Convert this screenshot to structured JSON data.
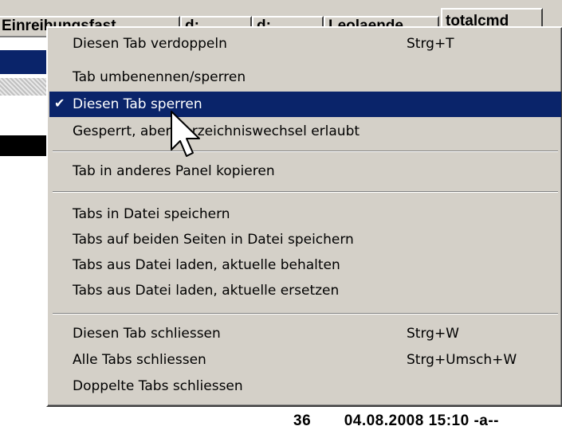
{
  "tabs": [
    {
      "label": "Einreibungsfast"
    },
    {
      "label": "d:"
    },
    {
      "label": "d:"
    },
    {
      "label": "Leolaende"
    },
    {
      "label": "totalcmd",
      "active": true
    }
  ],
  "menu": {
    "items": [
      {
        "label": "Diesen Tab verdoppeln",
        "shortcut": "Strg+T"
      },
      {
        "label": "Tab umbenennen/sperren",
        "shortcut": ""
      },
      {
        "label": "Diesen Tab sperren",
        "shortcut": "",
        "checked": true,
        "highlighted": true
      },
      {
        "label": "Gesperrt, aber Verzeichniswechsel erlaubt",
        "shortcut": ""
      },
      {
        "label": "Tab in anderes Panel kopieren",
        "shortcut": ""
      },
      {
        "label": "Tabs in Datei speichern",
        "shortcut": ""
      },
      {
        "label": "Tabs auf beiden Seiten in Datei speichern",
        "shortcut": ""
      },
      {
        "label": "Tabs aus Datei laden, aktuelle behalten",
        "shortcut": ""
      },
      {
        "label": "Tabs aus Datei laden, aktuelle ersetzen",
        "shortcut": ""
      },
      {
        "label": "Diesen Tab schliessen",
        "shortcut": "Strg+W"
      },
      {
        "label": "Alle Tabs schliessen",
        "shortcut": "Strg+Umsch+W"
      },
      {
        "label": "Doppelte Tabs schliessen",
        "shortcut": ""
      }
    ],
    "check_icon": "checkmark-icon"
  },
  "statusline": {
    "count": "36",
    "datetime": "04.08.2008 15:10",
    "attributes": "-a--"
  },
  "colors": {
    "highlight": "#0a246a",
    "menu_bg": "#d4d0c8",
    "titlebar_blue": "#0a246a"
  }
}
